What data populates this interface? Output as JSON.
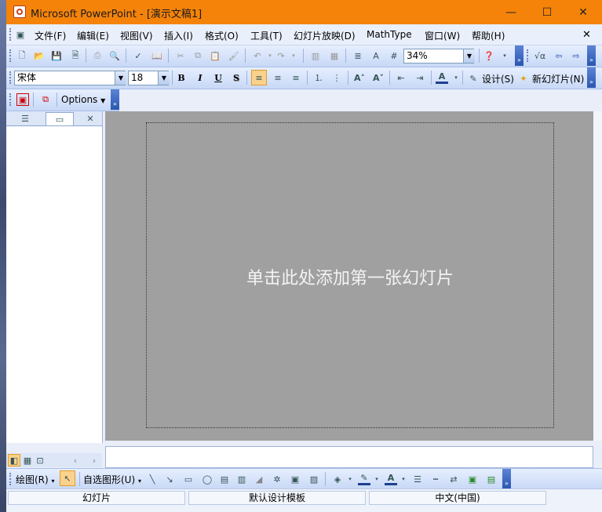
{
  "window": {
    "title": "Microsoft PowerPoint - [演示文稿1]",
    "minimize_glyph": "—",
    "maximize_glyph": "☐",
    "close_glyph": "✕",
    "doc_close_glyph": "✕"
  },
  "menubar": {
    "items": [
      {
        "label": "文件(F)"
      },
      {
        "label": "编辑(E)"
      },
      {
        "label": "视图(V)"
      },
      {
        "label": "插入(I)"
      },
      {
        "label": "格式(O)"
      },
      {
        "label": "工具(T)"
      },
      {
        "label": "幻灯片放映(D)"
      },
      {
        "label": "MathType"
      },
      {
        "label": "窗口(W)"
      },
      {
        "label": "帮助(H)"
      }
    ]
  },
  "standard_toolbar": {
    "zoom_value": "34%"
  },
  "formatting_toolbar": {
    "font_name": "宋体",
    "font_size": "18",
    "bold": "B",
    "italic": "I",
    "underline": "U",
    "shadow": "S",
    "design_label": "设计(S)",
    "new_slide_label": "新幻灯片(N)"
  },
  "addin_toolbar": {
    "options_label": "Options"
  },
  "slide": {
    "placeholder_text": "单击此处添加第一张幻灯片"
  },
  "drawing_toolbar": {
    "draw_label": "绘图(R)",
    "autoshape_label": "自选图形(U)"
  },
  "statusbar": {
    "view": "幻灯片",
    "template": "默认设计模板",
    "language": "中文(中国)"
  },
  "colors": {
    "titlebar": "#f5830a",
    "canvas": "#a0a0a0"
  }
}
